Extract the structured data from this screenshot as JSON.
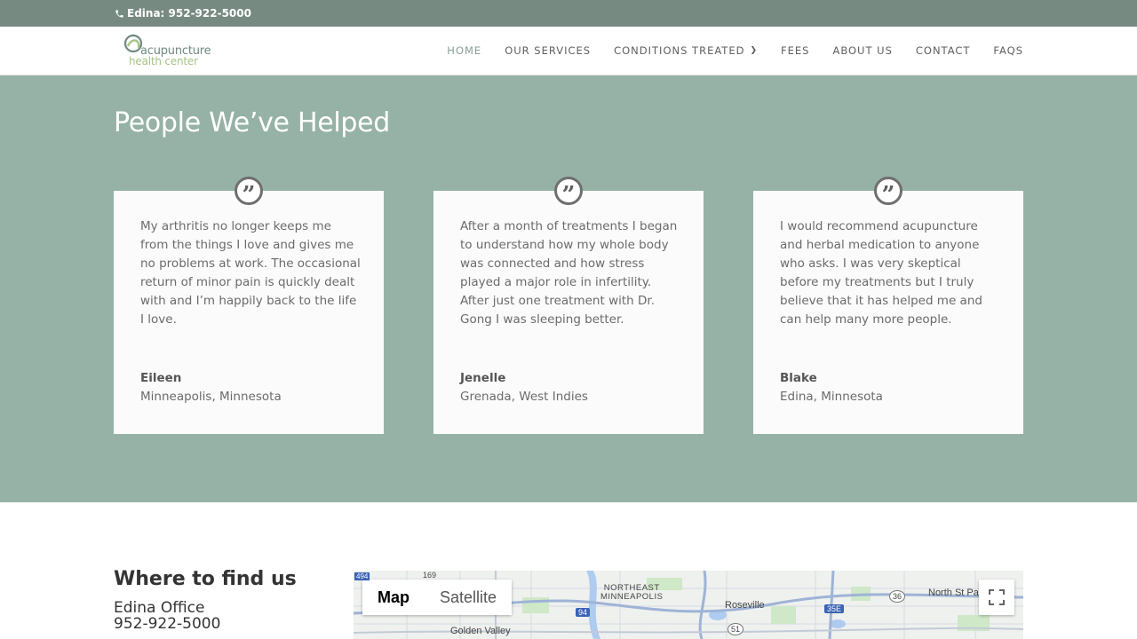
{
  "topbar": {
    "phone_label": "Edina: 952-922-5000"
  },
  "logo": {
    "line1": "acupuncture",
    "line2": "health center"
  },
  "nav": [
    {
      "label": "HOME"
    },
    {
      "label": "OUR SERVICES"
    },
    {
      "label": "CONDITIONS TREATED"
    },
    {
      "label": "FEES"
    },
    {
      "label": "ABOUT US"
    },
    {
      "label": "CONTACT"
    },
    {
      "label": "FAQS"
    }
  ],
  "testimonials": {
    "title": "People We’ve Helped",
    "quote_glyph": "”",
    "cards": [
      {
        "text": "My arthritis no longer keeps me from the things I love and gives me no problems at work. The occasional return of minor pain is quickly dealt with and I’m happily back to the life I love.",
        "name": "Eileen",
        "place": "Minneapolis, Minnesota"
      },
      {
        "text": "After a month of treatments I began to understand how my whole body was connected and how stress played a major role in infertility. After just one treatment with Dr. Gong I was sleeping better.",
        "name": "Jenelle",
        "place": "Grenada, West Indies"
      },
      {
        "text": "I would recommend acupuncture and herbal medication to anyone who asks. I was very skeptical before my treatments but I truly believe that it has helped me and can help many more people.",
        "name": "Blake",
        "place": "Edina, Minnesota"
      }
    ]
  },
  "location": {
    "title": "Where to find us",
    "office": "Edina Office",
    "phone": "952-922-5000"
  },
  "map": {
    "map_label": "Map",
    "satellite_label": "Satellite",
    "places": {
      "northeast_line1": "NORTHEAST",
      "northeast_line2": "MINNEAPOLIS",
      "roseville": "Roseville",
      "north_st_paul": "North St Pa",
      "golden_valley": "Golden Valley",
      "route_169": "169",
      "route_94": "94",
      "route_35e": "35E",
      "route_36": "36",
      "route_51": "51",
      "route_494": "494"
    }
  },
  "colors": {
    "topbar": "#778a82",
    "section_bg": "#96b2a6",
    "nav_active": "#8a9e97"
  }
}
